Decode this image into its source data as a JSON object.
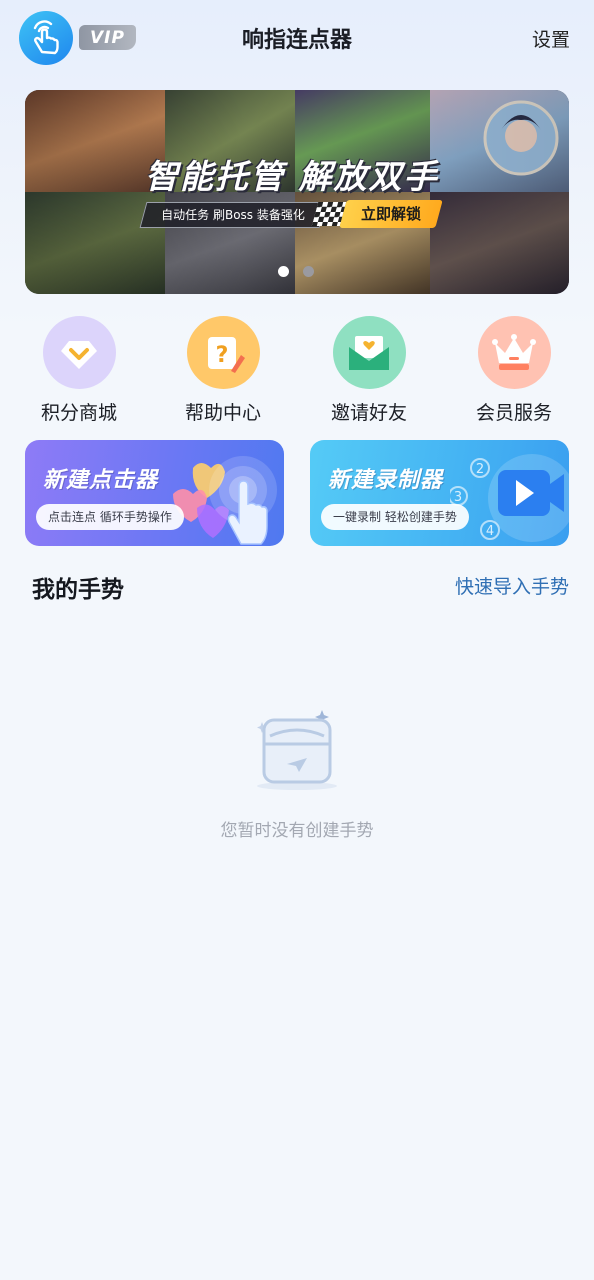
{
  "header": {
    "title": "响指连点器",
    "vip_badge": "VIP",
    "settings_label": "设置"
  },
  "banner": {
    "headline": "智能托管  解放双手",
    "subline": "自动任务 刷Boss 装备强化",
    "cta_label": "立即解锁",
    "slide_count": 2,
    "active_slide": 1
  },
  "quick_actions": [
    {
      "label": "积分商城",
      "icon": "diamond-icon",
      "color": "#d9d0fb"
    },
    {
      "label": "帮助中心",
      "icon": "help-icon",
      "color": "#ffc869"
    },
    {
      "label": "邀请好友",
      "icon": "invite-envelope-icon",
      "color": "#8fe0c1"
    },
    {
      "label": "会员服务",
      "icon": "crown-icon",
      "color": "#ffc2b2"
    }
  ],
  "cards": [
    {
      "title": "新建点击器",
      "subtitle": "点击连点 循环手势操作",
      "gradient_from": "#8a78f4",
      "gradient_to": "#5d78f2"
    },
    {
      "title": "新建录制器",
      "subtitle": "一键录制 轻松创建手势",
      "gradient_from": "#51c8f5",
      "gradient_to": "#3b9cf0"
    }
  ],
  "gestures": {
    "section_title": "我的手势",
    "import_label": "快速导入手势",
    "empty_text": "您暂时没有创建手势",
    "items": []
  },
  "colors": {
    "link": "#2f6fb4",
    "background": "#f3f7fc",
    "cta": "#ffb42a"
  }
}
